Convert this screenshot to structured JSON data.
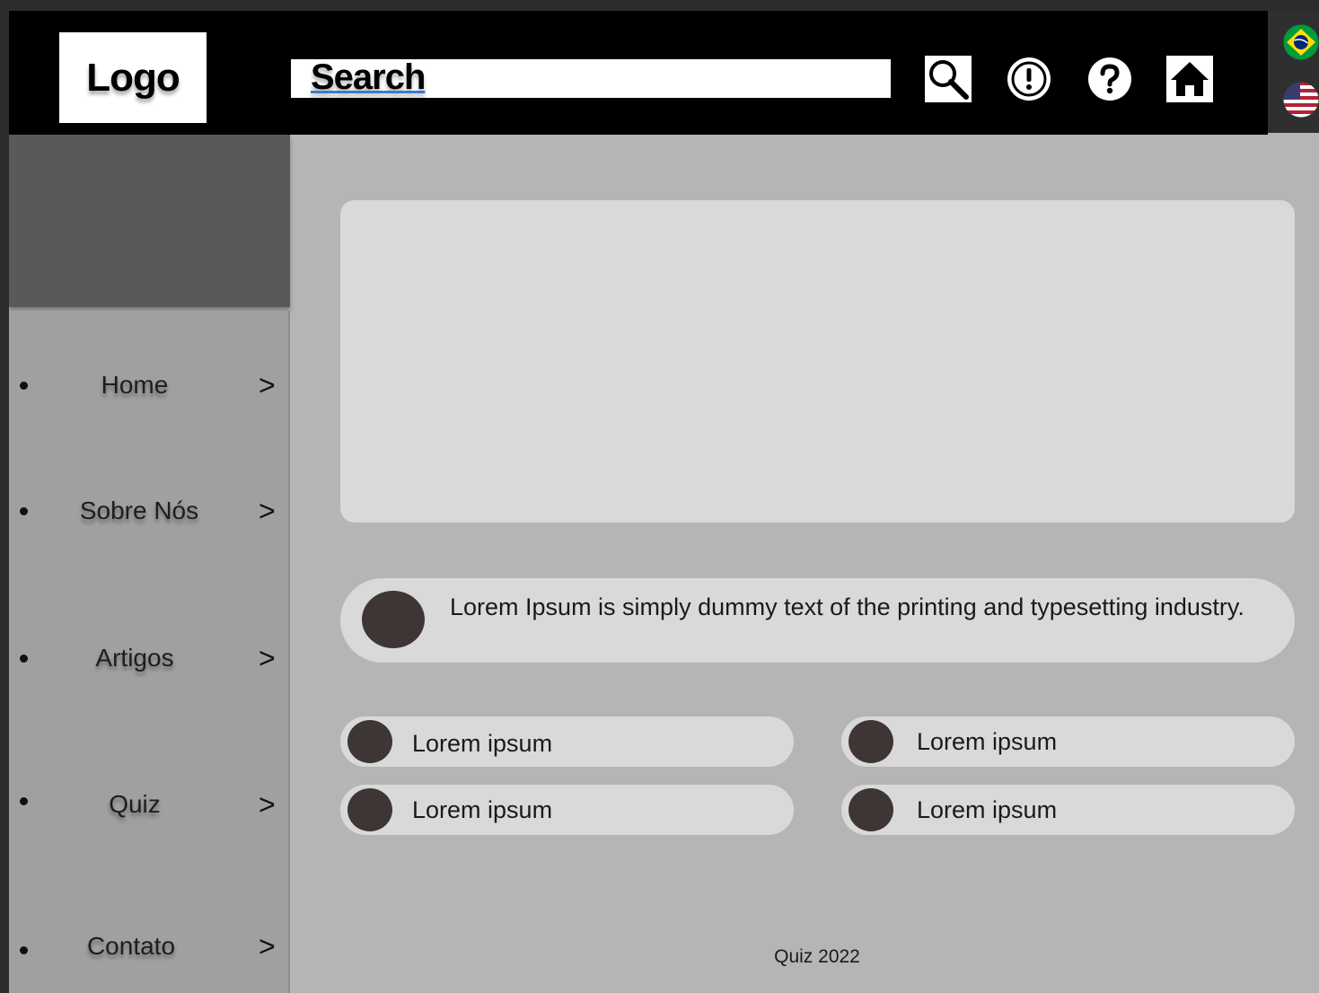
{
  "header": {
    "logo": "Logo",
    "search_text": "Search"
  },
  "sidebar": {
    "items": [
      {
        "label": "Home",
        "chevron": ">"
      },
      {
        "label": "Sobre Nós",
        "chevron": ">"
      },
      {
        "label": "Artigos",
        "chevron": ">"
      },
      {
        "label": "Quiz",
        "chevron": ">"
      },
      {
        "label": "Contato",
        "chevron": ">"
      }
    ]
  },
  "main": {
    "info_text": "Lorem Ipsum is simply dummy text of the printing and typesetting industry.",
    "options": [
      {
        "label": "Lorem ipsum"
      },
      {
        "label": "Lorem ipsum"
      },
      {
        "label": "Lorem ipsum"
      },
      {
        "label": "Lorem ipsum"
      }
    ]
  },
  "footer": {
    "text": "Quiz 2022"
  },
  "icons": {
    "header": [
      "search-icon",
      "alert-icon",
      "help-icon",
      "home-icon"
    ],
    "languages": [
      "brazil-flag-icon",
      "usa-flag-icon"
    ]
  },
  "colors": {
    "header_bg": "#000000",
    "page_bg": "#b5b5b5",
    "card_bg": "#d9d9d9",
    "dot": "#3e3535",
    "sidebar_bg": "#a0a0a0",
    "sidebar_top_bg": "#595959"
  }
}
